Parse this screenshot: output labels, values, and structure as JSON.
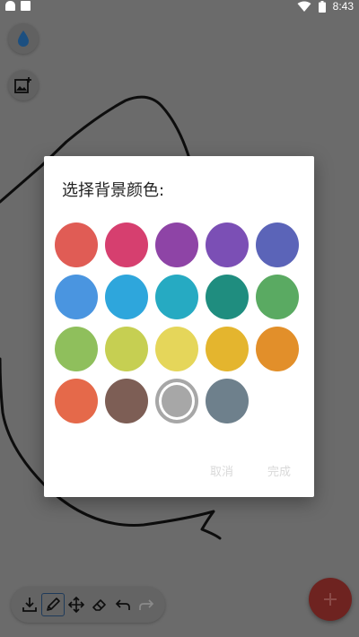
{
  "status_bar": {
    "time": "8:43"
  },
  "icons": {
    "status_left": [
      "android-icon",
      "document-icon"
    ],
    "status_right": [
      "wifi-icon",
      "battery-icon"
    ],
    "float_buttons": [
      "ink-drop-icon",
      "add-image-icon"
    ],
    "toolbar": [
      "save-download-icon",
      "pencil-icon",
      "move-icon",
      "eraser-icon",
      "undo-icon",
      "redo-icon"
    ],
    "fab": "plus-icon"
  },
  "dialog": {
    "title": "选择背景颜色:",
    "cancel_label": "取消",
    "done_label": "完成",
    "colors": [
      "#e05c55",
      "#d63f6f",
      "#8e44a6",
      "#7b4fb5",
      "#5b64b8",
      "#4a95e0",
      "#2ea6dc",
      "#26aac2",
      "#1f8d7f",
      "#5aaa62",
      "#8fbf5c",
      "#c6cf52",
      "#e5d65a",
      "#e4b52e",
      "#e28f2a",
      "#e5694a",
      "#7d5e55",
      "#a7a7a7",
      "#6e808c"
    ],
    "selected_color": "#a7a7a7"
  },
  "theme": {
    "fab_color": "#6e2320",
    "toolbar_active_border": "#1e3a5a",
    "dialog_button_color": "#d9d9d9"
  }
}
